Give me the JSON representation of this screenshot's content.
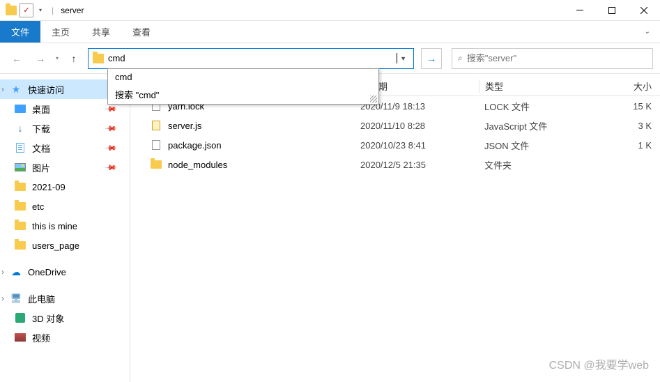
{
  "titlebar": {
    "title": "server",
    "separator": "|"
  },
  "tabs": {
    "file": "文件",
    "home": "主页",
    "share": "共享",
    "view": "查看"
  },
  "address": {
    "input_value": "cmd",
    "dropdown": {
      "item1": "cmd",
      "item2": "搜索 \"cmd\""
    }
  },
  "search": {
    "placeholder": "搜索\"server\""
  },
  "sidebar": {
    "quick": "快速访问",
    "desktop": "桌面",
    "downloads": "下载",
    "documents": "文档",
    "pictures": "图片",
    "f1": "2021-09",
    "f2": "etc",
    "f3": "this is mine",
    "f4": "users_page",
    "onedrive": "OneDrive",
    "thispc": "此电脑",
    "obj3d": "3D 对象",
    "videos": "视频"
  },
  "columns": {
    "date": "攻日期",
    "type": "类型",
    "size": "大小"
  },
  "files": [
    {
      "name": "yarn.lock",
      "date": "2020/11/9 18:13",
      "type": "LOCK 文件",
      "size": "15 K",
      "icon": "lock"
    },
    {
      "name": "server.js",
      "date": "2020/11/10 8:28",
      "type": "JavaScript 文件",
      "size": "3 K",
      "icon": "js"
    },
    {
      "name": "package.json",
      "date": "2020/10/23 8:41",
      "type": "JSON 文件",
      "size": "1 K",
      "icon": "json"
    },
    {
      "name": "node_modules",
      "date": "2020/12/5 21:35",
      "type": "文件夹",
      "size": "",
      "icon": "folder"
    }
  ],
  "watermark": "CSDN @我要学web"
}
